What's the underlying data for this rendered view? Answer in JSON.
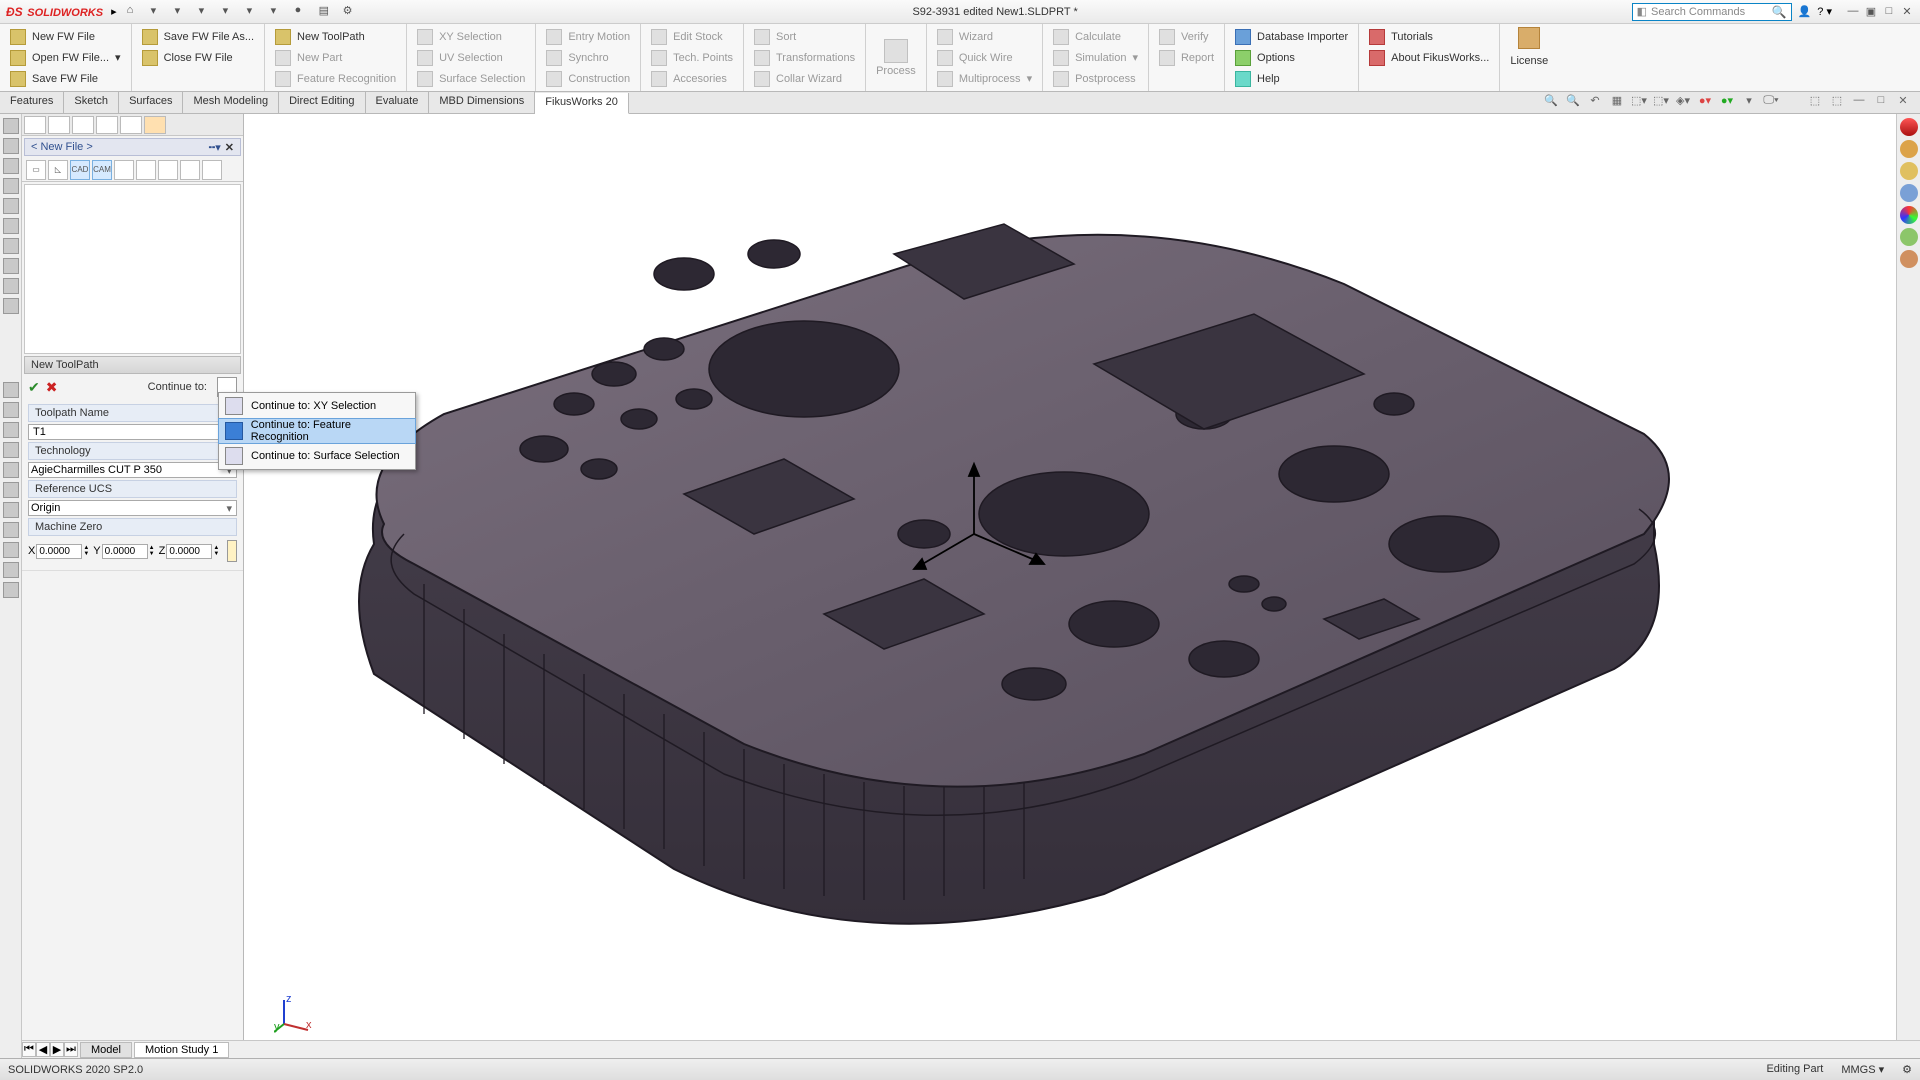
{
  "app": {
    "title": "S92-3931 edited New1.SLDPRT *",
    "brand": "SOLIDWORKS"
  },
  "search": {
    "placeholder": "Search Commands"
  },
  "ribbon": {
    "fw": {
      "new": "New FW File",
      "open": "Open FW File...",
      "save": "Save FW File",
      "saveas": "Save FW File As...",
      "close": "Close FW File"
    },
    "tp": {
      "new": "New ToolPath",
      "newpart": "New Part",
      "featrec": "Feature Recognition"
    },
    "sel": {
      "xy": "XY Selection",
      "uv": "UV Selection",
      "surf": "Surface Selection"
    },
    "motion": {
      "entry": "Entry Motion",
      "synchro": "Synchro",
      "constr": "Construction"
    },
    "stock": {
      "edit": "Edit Stock",
      "techp": "Tech. Points",
      "acc": "Accesories"
    },
    "sort": {
      "sort": "Sort",
      "trans": "Transformations",
      "collar": "Collar Wizard"
    },
    "process": {
      "label": "Process"
    },
    "wiz": {
      "wizard": "Wizard",
      "quick": "Quick Wire",
      "multi": "Multiprocess"
    },
    "calc": {
      "calc": "Calculate",
      "sim": "Simulation",
      "post": "Postprocess"
    },
    "ver": {
      "verify": "Verify",
      "report": "Report"
    },
    "extra": {
      "db": "Database Importer",
      "options": "Options",
      "help": "Help",
      "tutorials": "Tutorials",
      "about": "About FikusWorks...",
      "license": "License"
    }
  },
  "tabs": [
    "Features",
    "Sketch",
    "Surfaces",
    "Mesh Modeling",
    "Direct Editing",
    "Evaluate",
    "MBD Dimensions",
    "FikusWorks 20"
  ],
  "panel": {
    "file_header": "< New File >",
    "cad": "CAD",
    "cam": "CAM",
    "section": "New ToolPath",
    "continue_to": "Continue to:",
    "toolpath_name_label": "Toolpath Name",
    "toolpath_name_value": "T1",
    "technology_label": "Technology",
    "technology_value": "AgieCharmilles CUT P 350",
    "refucs_label": "Reference UCS",
    "refucs_value": "Origin",
    "mzero_label": "Machine Zero",
    "x": "0.0000",
    "y": "0.0000",
    "z": "0.0000"
  },
  "context_menu": {
    "items": [
      "Continue to: XY Selection",
      "Continue to: Feature Recognition",
      "Continue to: Surface Selection"
    ]
  },
  "bottom_tabs": {
    "model": "Model",
    "motion": "Motion Study 1"
  },
  "status": {
    "left": "SOLIDWORKS 2020 SP2.0",
    "mode": "Editing Part",
    "units": "MMGS"
  }
}
